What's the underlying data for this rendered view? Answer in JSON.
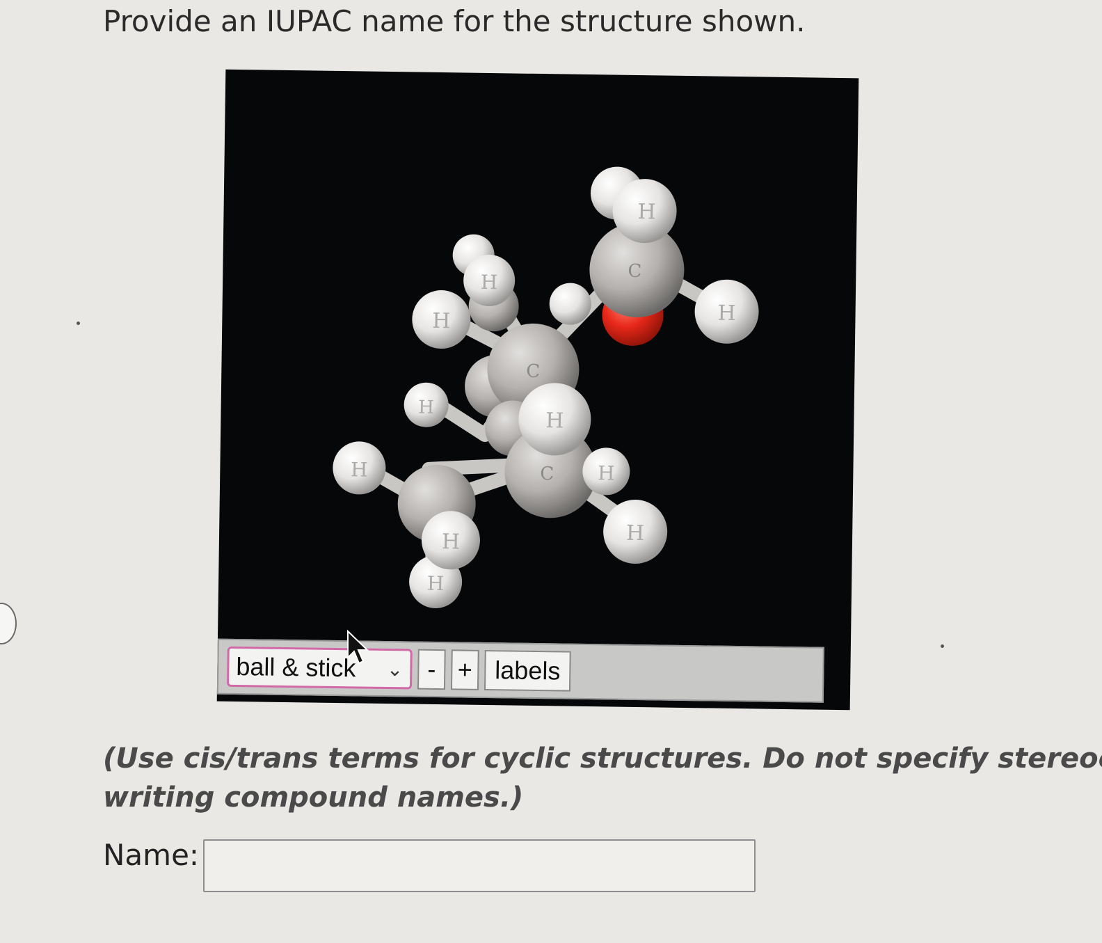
{
  "question": {
    "text": "Provide an IUPAC name for the structure shown."
  },
  "viewer": {
    "render_mode": "ball & stick",
    "render_mode_options": [
      "ball & stick"
    ],
    "zoom_out_label": "-",
    "zoom_in_label": "+",
    "labels_button": "labels",
    "atom_label_carbon": "C",
    "atom_label_hydrogen": "H",
    "atom_label_oxygen": "O",
    "background_color": "#050708",
    "carbon_color": "#b4b1ae",
    "hydrogen_color": "#e6e4e2",
    "oxygen_color": "#e8281a"
  },
  "instructions": {
    "line1": "(Use cis/trans terms for cyclic structures. Do not specify stereoch",
    "line2": "writing compound names.)"
  },
  "answer": {
    "label": "Name:",
    "value": "",
    "placeholder": ""
  },
  "icons": {
    "cursor": "mouse-pointer-icon",
    "dropdown": "chevron-down-icon",
    "nav": "previous-arrow-icon"
  }
}
